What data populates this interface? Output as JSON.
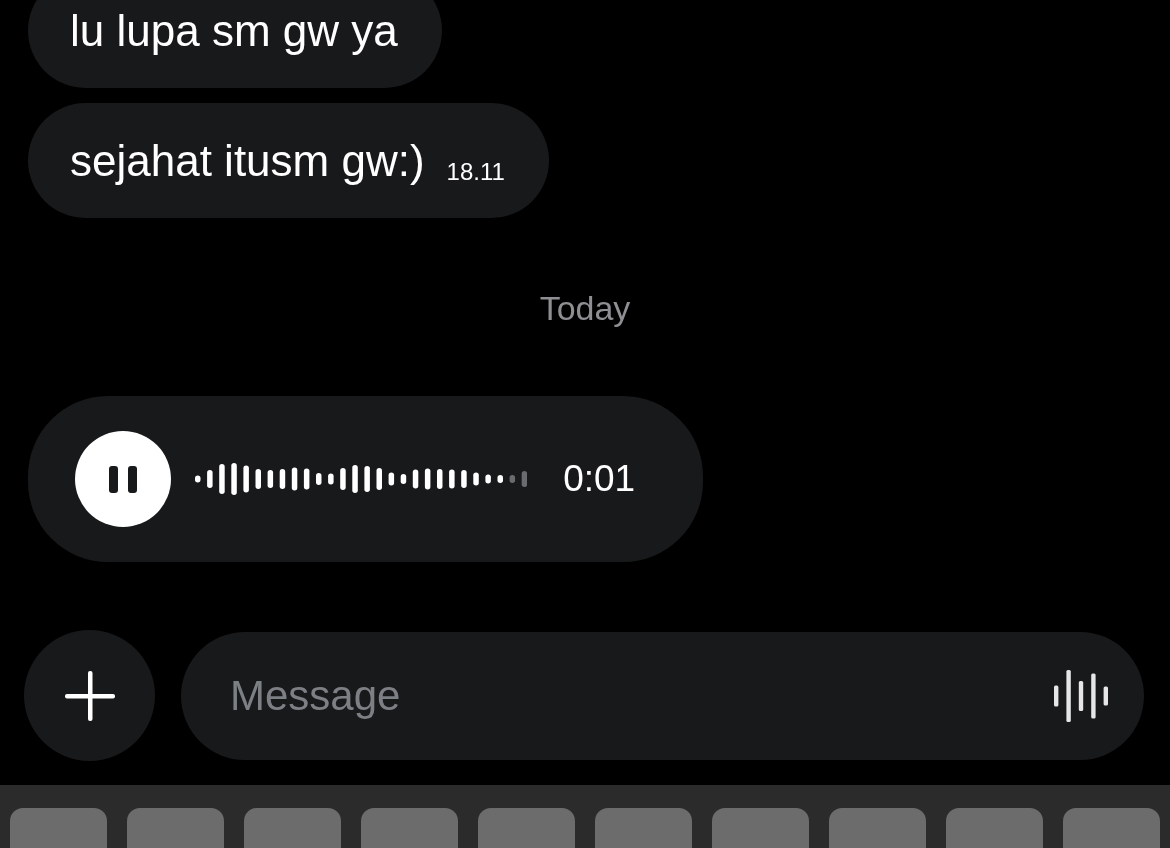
{
  "messages": [
    {
      "kind": "text",
      "text": "lu lupa sm gw ya"
    },
    {
      "kind": "text",
      "text": "sejahat itusm gw:)",
      "time": "18.11"
    },
    {
      "kind": "date",
      "text": "Today"
    },
    {
      "kind": "voice",
      "playing": true,
      "level": 0.93,
      "duration": "0:01"
    }
  ],
  "composer": {
    "placeholder": "Message"
  }
}
